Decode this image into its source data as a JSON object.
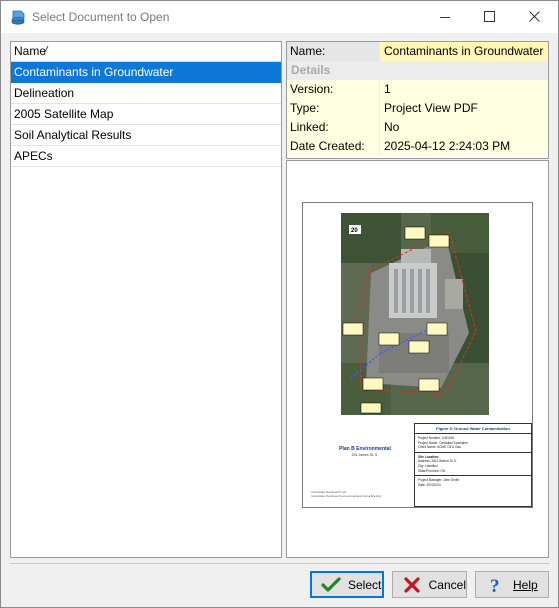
{
  "window": {
    "title": "Select Document to Open"
  },
  "list": {
    "header": "Name",
    "items": [
      {
        "label": "Contaminants in Groundwater",
        "selected": true
      },
      {
        "label": "Delineation",
        "selected": false
      },
      {
        "label": "2005 Satellite Map",
        "selected": false
      },
      {
        "label": "Soil Analytical Results",
        "selected": false
      },
      {
        "label": "APECs",
        "selected": false
      }
    ]
  },
  "properties": {
    "name_label": "Name:",
    "name_value": "Contaminants in Groundwater",
    "details_label": "Details",
    "version_label": "Version:",
    "version_value": "1",
    "type_label": "Type:",
    "type_value": "Project View PDF",
    "linked_label": "Linked:",
    "linked_value": "No",
    "date_label": "Date Created:",
    "date_value": "2025-04-12 2:24:03 PM"
  },
  "preview": {
    "map_number": "20",
    "firm_name": "Plan B Environmental",
    "firm_address": "201 James St, S.",
    "legend_1": "Groundwater Results ■ 0.5 ug/L",
    "legend_2": "Groundwater Results ■ 0.5 exceeds regulatory limit ■ Boundary",
    "figure_title": "Figure 5: Ground Water Contamination",
    "project_number": "Project Number:  CAD106",
    "project_name": "Project Name:  Canadian Examples",
    "client_name": "Client Name:  ACME Oil & Gas",
    "site_location": "Site Location:",
    "address": "Address:  2811 Barton St. E",
    "city": "City:  Hamilton",
    "state": "State/Province:  ON",
    "manager": "Project Manager:  John Smith",
    "date": "Date:  2023/2/24"
  },
  "buttons": {
    "select": "Select",
    "cancel": "Cancel",
    "help": "Help"
  },
  "colors": {
    "selection": "#0f78d7",
    "property_bg": "#ffffe1",
    "brand_blue": "#1a3aa0"
  }
}
